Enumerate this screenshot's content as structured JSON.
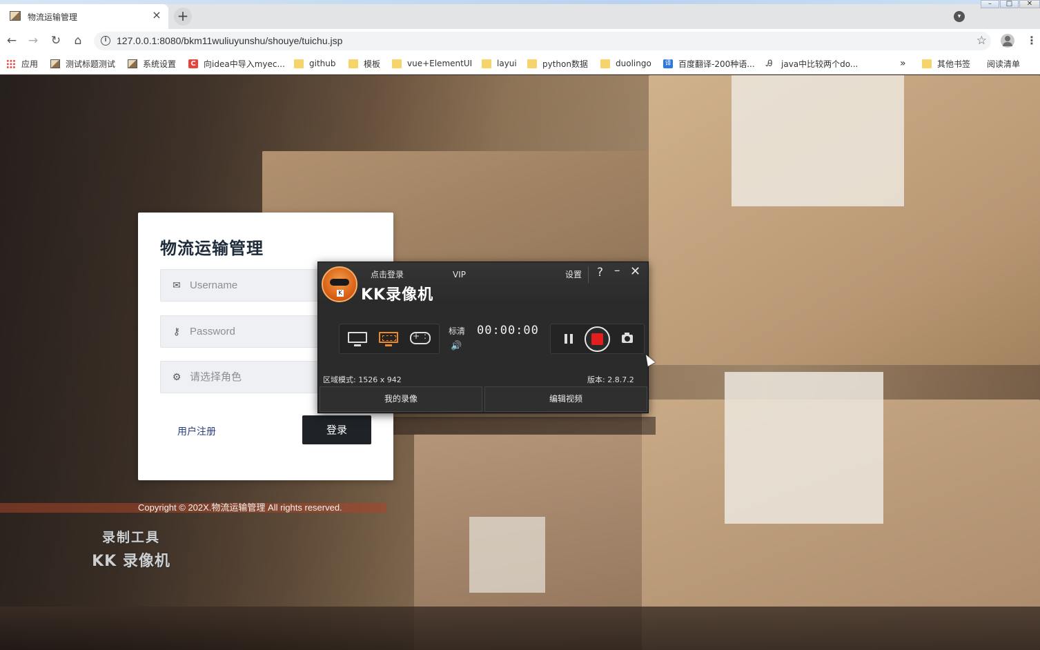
{
  "browser": {
    "tab_title": "物流运输管理",
    "url": "127.0.0.1:8080/bkm11wuliuyunshu/shouye/tuichu.jsp",
    "bookmarks": [
      {
        "label": "应用",
        "icon": "apps-grid-icon"
      },
      {
        "label": "测试标题测试",
        "icon": "image-icon"
      },
      {
        "label": "系统设置",
        "icon": "image-icon"
      },
      {
        "label": "向idea中导入myec...",
        "icon": "csdn-icon"
      },
      {
        "label": "github",
        "icon": "folder-icon"
      },
      {
        "label": "模板",
        "icon": "folder-icon"
      },
      {
        "label": "vue+ElementUI",
        "icon": "folder-icon"
      },
      {
        "label": "layui",
        "icon": "folder-icon"
      },
      {
        "label": "python数据",
        "icon": "folder-icon"
      },
      {
        "label": "duolingo",
        "icon": "folder-icon"
      },
      {
        "label": "百度翻译-200种语...",
        "icon": "translate-icon"
      },
      {
        "label": "java中比较两个do...",
        "icon": "ai-icon"
      }
    ],
    "overflow_label": "»",
    "other_bookmarks": "其他书签",
    "reading_list": "阅读清单"
  },
  "login": {
    "title": "物流运输管理",
    "username_placeholder": "Username",
    "password_placeholder": "Password",
    "role_placeholder": "请选择角色",
    "register_link": "用户注册",
    "login_button": "登录"
  },
  "footer": {
    "copyright": "Copyright © 202X.物流运输管理 All rights reserved."
  },
  "watermark": {
    "line1": "录制工具",
    "line2": "KK 录像机"
  },
  "recorder": {
    "login_label": "点击登录",
    "vip_label": "VIP",
    "brand": "KK录像机",
    "settings_label": "设置",
    "help_label": "?",
    "quality_label": "标清",
    "timer": "00:00:00",
    "mode_info": "区域模式: 1526 x 942",
    "version": "版本: 2.8.7.2",
    "my_recordings": "我的录像",
    "edit_video": "编辑视频",
    "active_mode": "region"
  }
}
